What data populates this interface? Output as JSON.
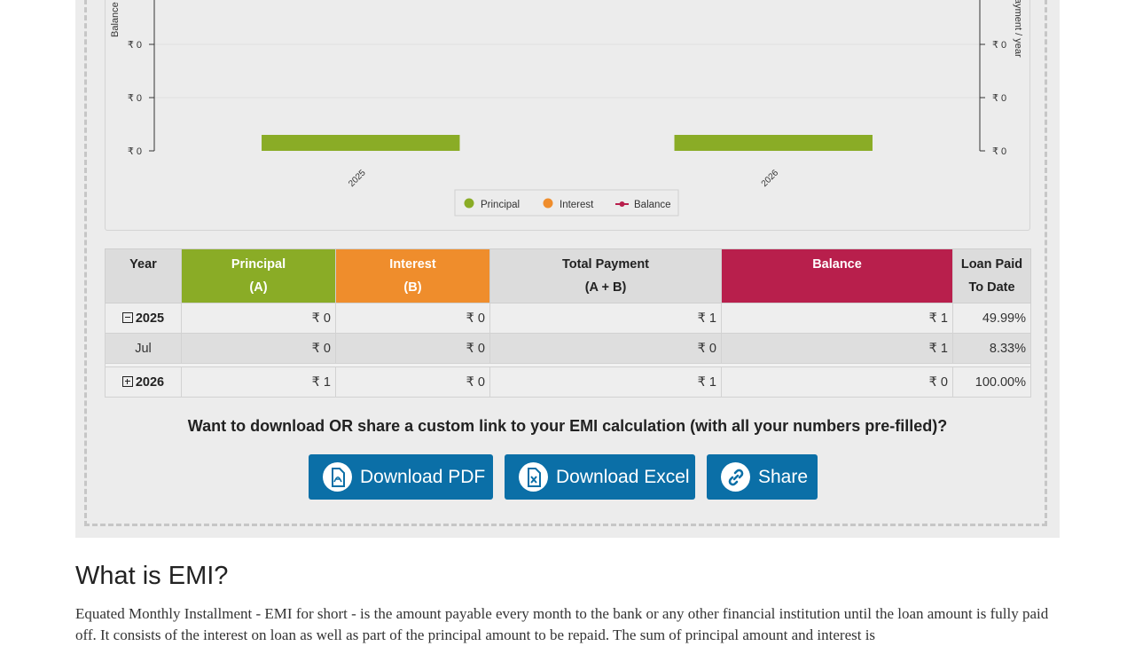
{
  "chart_data": {
    "type": "bar",
    "categories": [
      "2025",
      "2026"
    ],
    "series": [
      {
        "name": "Principal",
        "values": [
          0,
          1
        ],
        "color": "#8aac26"
      },
      {
        "name": "Interest",
        "values": [
          0,
          0
        ],
        "color": "#ef8d2c"
      },
      {
        "name": "Balance",
        "values": [
          1,
          0
        ],
        "color": "#b81f4c"
      }
    ],
    "ylabel_left": "Balance",
    "ylabel_right": "ayment / year",
    "left_tick_labels": [
      "₹ 0",
      "₹ 0",
      "₹ 0"
    ],
    "right_tick_labels": [
      "₹ 0",
      "₹ 0",
      "₹ 0"
    ],
    "legend_position": "bottom-center",
    "legend": [
      "Principal",
      "Interest",
      "Balance"
    ]
  },
  "table": {
    "headers": {
      "year": "Year",
      "principal_1": "Principal",
      "principal_2": "(A)",
      "interest_1": "Interest",
      "interest_2": "(B)",
      "total_1": "Total Payment",
      "total_2": "(A + B)",
      "balance": "Balance",
      "paid_1": "Loan Paid",
      "paid_2": "To Date"
    },
    "rows": [
      {
        "year": "2025",
        "principal": "₹ 0",
        "interest": "₹ 0",
        "total": "₹ 1",
        "balance": "₹ 1",
        "paid": "49.99%"
      },
      {
        "month": "Jul",
        "principal": "₹ 0",
        "interest": "₹ 0",
        "total": "₹ 0",
        "balance": "₹ 1",
        "paid": "8.33%"
      },
      {
        "year": "2026",
        "principal": "₹ 1",
        "interest": "₹ 0",
        "total": "₹ 1",
        "balance": "₹ 0",
        "paid": "100.00%"
      }
    ]
  },
  "share": {
    "prompt": "Want to download OR share a custom link to your EMI calculation (with all your numbers pre-filled)?",
    "pdf_label": "Download PDF",
    "excel_label": "Download Excel",
    "share_label": "Share",
    "icons": [
      "pdf-icon",
      "excel-icon",
      "link-icon"
    ]
  },
  "article": {
    "title": "What is EMI?",
    "body": "Equated Monthly Installment - EMI for short - is the amount payable every month to the bank or any other financial institution until the loan amount is fully paid off. It consists of the interest on loan as well as part of the principal amount to be repaid. The sum of principal amount and interest is"
  },
  "colors": {
    "button": "#0b6fa7",
    "principal": "#8aac26",
    "interest": "#ef8d2c",
    "balance": "#b81f4c"
  }
}
